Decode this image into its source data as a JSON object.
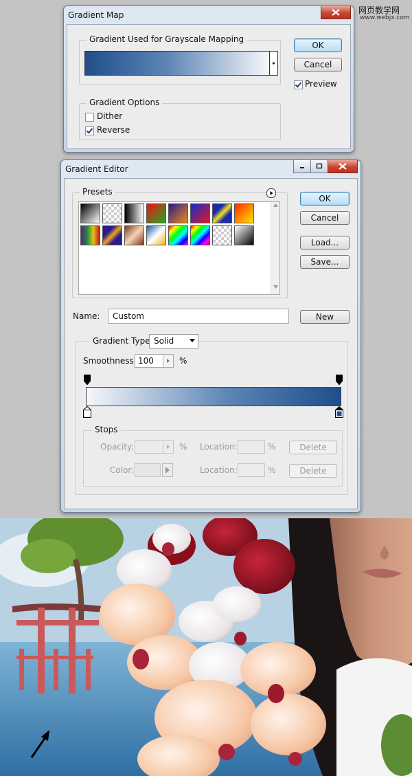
{
  "watermark": {
    "line1": "网页教学网",
    "line2": "www.webjx.com"
  },
  "gradient_map": {
    "title": "Gradient Map",
    "group_gradient": "Gradient Used for Grayscale Mapping",
    "group_options": "Gradient Options",
    "dither_label": "Dither",
    "dither_checked": false,
    "reverse_label": "Reverse",
    "reverse_checked": true,
    "ok": "OK",
    "cancel": "Cancel",
    "preview_label": "Preview",
    "preview_checked": true
  },
  "gradient_editor": {
    "title": "Gradient Editor",
    "presets_label": "Presets",
    "ok": "OK",
    "cancel": "Cancel",
    "load": "Load...",
    "save": "Save...",
    "name_label": "Name:",
    "name_value": "Custom",
    "new": "New",
    "gradient_type_label": "Gradient Type:",
    "gradient_type_value": "Solid",
    "smoothness_label": "Smoothness:",
    "smoothness_value": "100",
    "percent": "%",
    "stops_label": "Stops",
    "opacity_label": "Opacity:",
    "color_label": "Color:",
    "location_label_1": "Location:",
    "location_label_2": "Location:",
    "delete_1": "Delete",
    "delete_2": "Delete",
    "colors": {
      "dark_stop": "#1f4e8c",
      "light_stop": "#f6f8fb"
    }
  }
}
